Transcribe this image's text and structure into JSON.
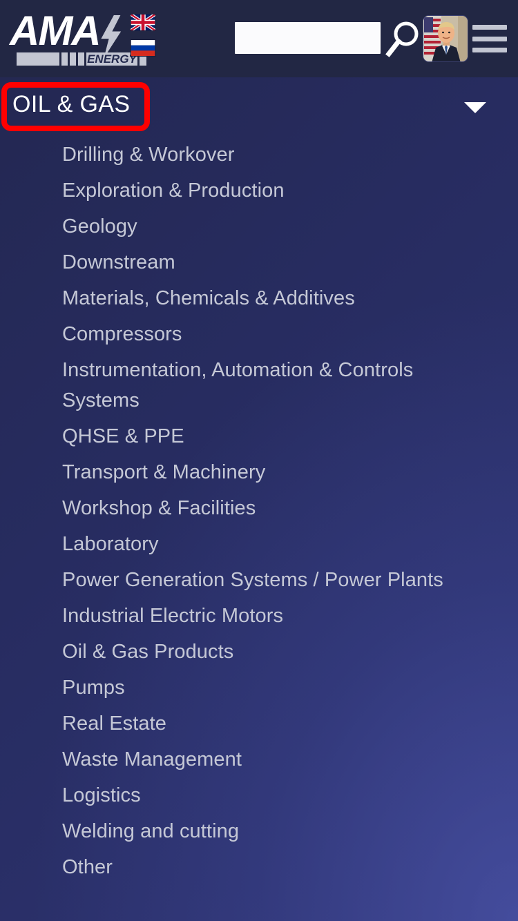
{
  "header": {
    "logo": {
      "wordmark": "AMA",
      "subtext": "ENERGY",
      "bolt_icon": "lightning-bolt-icon"
    },
    "languages": [
      {
        "code": "en",
        "name": "English",
        "flag": "uk-flag"
      },
      {
        "code": "ru",
        "name": "Russian",
        "flag": "russia-flag"
      }
    ],
    "search": {
      "value": "",
      "placeholder": ""
    },
    "search_icon": "magnifier-icon",
    "avatar_alt": "user-avatar",
    "menu_icon": "hamburger-menu-icon"
  },
  "section": {
    "title": "OIL & GAS",
    "expand_icon": "chevron-down-icon",
    "highlight_color": "#ff0000"
  },
  "menu": {
    "items": [
      "Drilling & Workover",
      "Exploration & Production",
      "Geology",
      "Downstream",
      "Materials, Chemicals & Additives",
      "Compressors",
      "Instrumentation, Automation & Controls Systems",
      "QHSE & PPE",
      "Transport & Machinery",
      "Workshop & Facilities",
      "Laboratory",
      "Power Generation Systems / Power Plants",
      "Industrial Electric Motors",
      "Oil & Gas Products",
      "Pumps",
      "Real Estate",
      "Waste Management",
      "Logistics",
      "Welding and cutting",
      "Other"
    ]
  },
  "theme": {
    "background": "#272c60",
    "header_background": "#222744",
    "text": "#c5c8d6",
    "accent": "#c3c6d2"
  }
}
